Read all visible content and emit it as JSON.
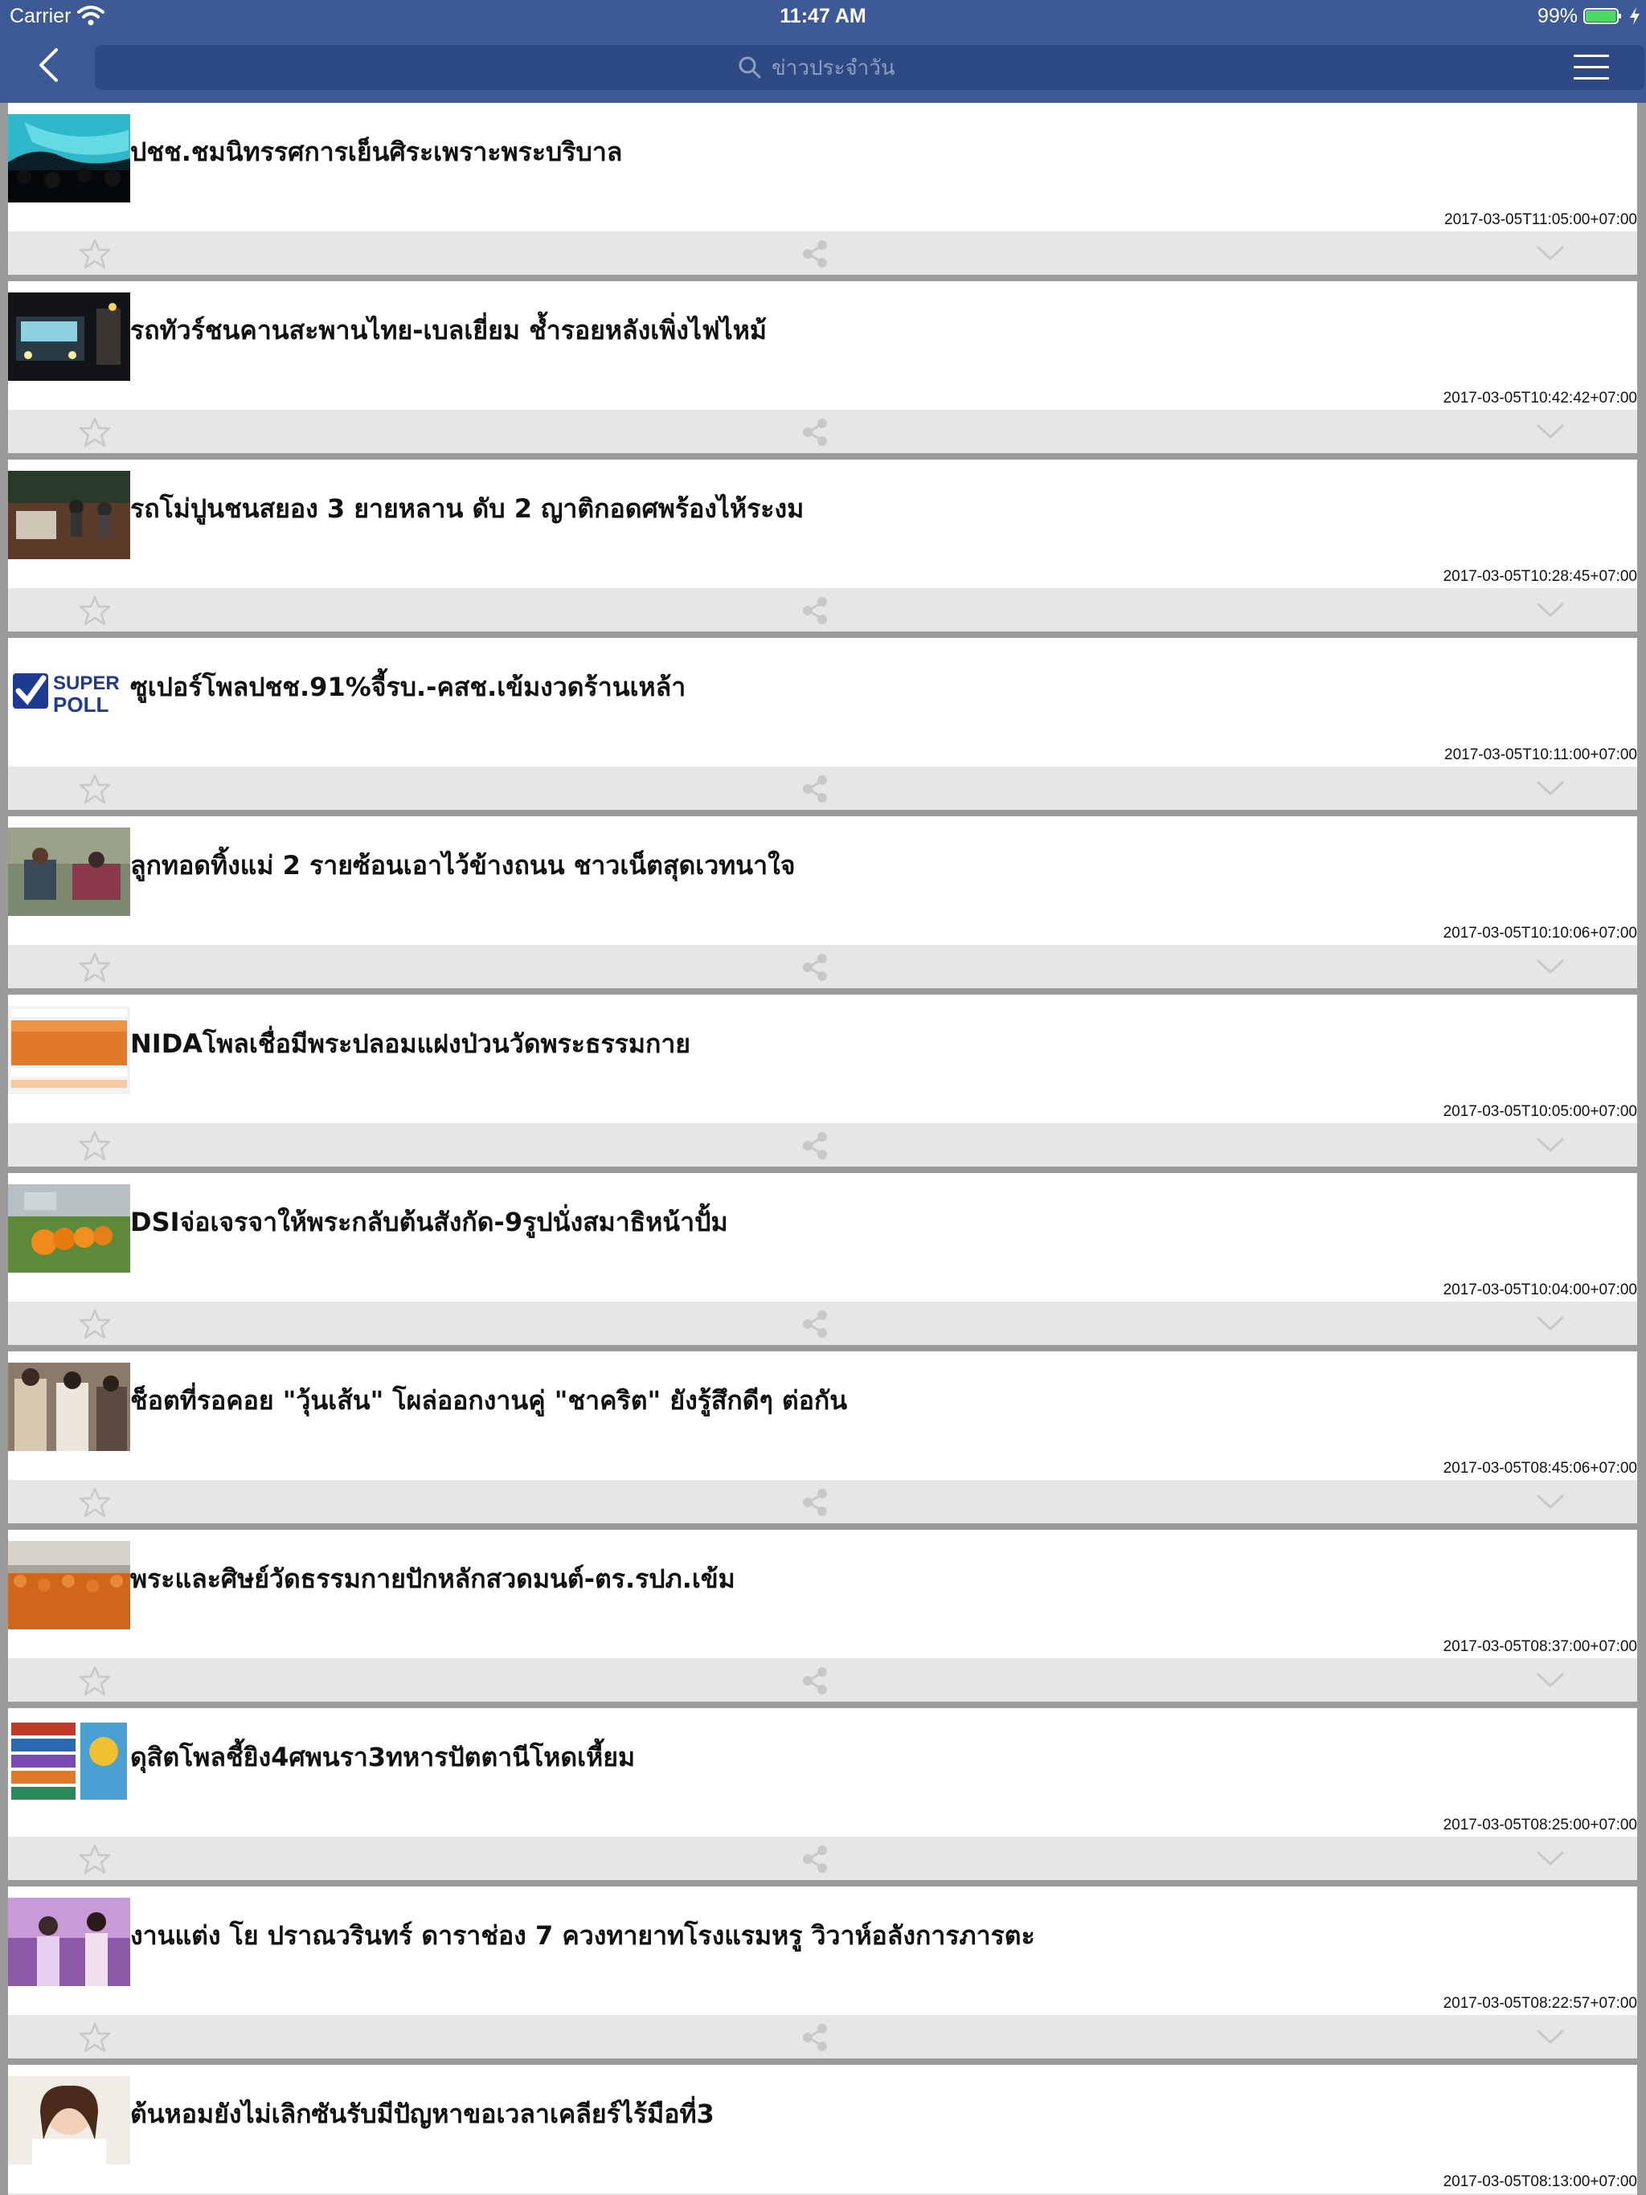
{
  "status_bar": {
    "carrier": "Carrier",
    "time": "11:47 AM",
    "battery_percent": "99%",
    "battery_level": 0.99,
    "battery_color": "#4cd964"
  },
  "nav": {
    "back_icon": "chevron-left-icon",
    "search_placeholder": "ข่าวประจำวัน",
    "menu_icon": "hamburger-menu-icon",
    "bar_color": "#3d5a96",
    "search_bg_color": "#2d4a84"
  },
  "news": [
    {
      "title": "ปชช.ชมนิทรรศการเย็นศิระเพราะพระบริบาล",
      "timestamp": "2017-03-05T11:05:00+07:00",
      "thumb": "crowd-light-display"
    },
    {
      "title": "รถทัวร์ชนคานสะพานไทย-เบลเยี่ยม ช้ำรอยหลังเพิ่งไฟไหม้",
      "timestamp": "2017-03-05T10:42:42+07:00",
      "thumb": "bus-night"
    },
    {
      "title": "รถโม่ปูนชนสยอง 3 ยายหลาน ดับ 2 ญาติกอดศพร้องไห้ระงม",
      "timestamp": "2017-03-05T10:28:45+07:00",
      "thumb": "accident-scene"
    },
    {
      "title": "ซูเปอร์โพลปชช.91%จี้รบ.-คสช.เข้มงวดร้านเหล้า",
      "timestamp": "2017-03-05T10:11:00+07:00",
      "thumb": "super-poll-logo",
      "logo_text_1": "SUPER",
      "logo_text_2": "POLL"
    },
    {
      "title": "ลูกทอดทิ้งแม่ 2 รายซ้อนเอาไว้ข้างถนน ชาวเน็ตสุดเวทนาใจ",
      "timestamp": "2017-03-05T10:10:06+07:00",
      "thumb": "street-scene"
    },
    {
      "title": "NIDAโพลเชื่อมีพระปลอมแฝงป่วนวัดพระธรรมกาย",
      "timestamp": "2017-03-05T10:05:00+07:00",
      "thumb": "poll-infographic"
    },
    {
      "title": "DSIจ่อเจรจาให้พระกลับต้นสังกัด-9รูปนั่งสมาธิหน้าปั้ม",
      "timestamp": "2017-03-05T10:04:00+07:00",
      "thumb": "monks-meditating"
    },
    {
      "title": "ช็อตที่รอคอย \"วุ้นเส้น\" โผล่ออกงานคู่ \"ชาคริต\" ยังรู้สึกดีๆ ต่อกัน",
      "timestamp": "2017-03-05T08:45:06+07:00",
      "thumb": "celebrities-event"
    },
    {
      "title": "พระและศิษย์วัดธรรมกายปักหลักสวดมนต์-ตร.รปภ.เข้ม",
      "timestamp": "2017-03-05T08:37:00+07:00",
      "thumb": "monks-crowd"
    },
    {
      "title": "ดุสิตโพลชี้ยิง4ศพนรา3ทหารปัตตานีโหดเหี้ยม",
      "timestamp": "2017-03-05T08:25:00+07:00",
      "thumb": "poll-chart"
    },
    {
      "title": "งานแต่ง โย ปราณวรินทร์ ดาราช่อง 7 ควงทายาทโรงแรมหรู วิวาห์อลังการภารตะ",
      "timestamp": "2017-03-05T08:22:57+07:00",
      "thumb": "wedding-purple"
    },
    {
      "title": "ต้นหอมยังไม่เลิกซันรับมีปัญหาขอเวลาเคลียร์ไร้มือที่3",
      "timestamp": "2017-03-05T08:13:00+07:00",
      "thumb": "actress-portrait"
    }
  ],
  "card_icons": {
    "star": "star-outline-icon",
    "share": "share-icon",
    "expand": "chevron-down-icon"
  }
}
